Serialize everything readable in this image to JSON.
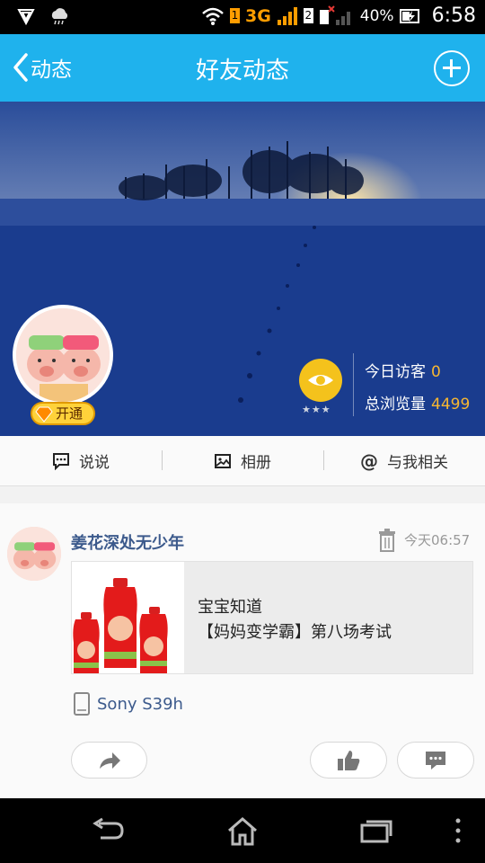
{
  "status_bar": {
    "network": "3G",
    "sim1": "1",
    "sim2": "2",
    "battery": "40%",
    "time": "6:58"
  },
  "header": {
    "back_label": "动态",
    "title": "好友动态",
    "background_color": "#1fb2ed"
  },
  "profile": {
    "vip_label": "开通",
    "visitors_today_label": "今日访客",
    "visitors_today": "0",
    "total_views_label": "总浏览量",
    "total_views": "4499",
    "stars": "★★★"
  },
  "tabs": [
    {
      "label": "说说",
      "icon": "chat-bubble-icon"
    },
    {
      "label": "相册",
      "icon": "photo-icon"
    },
    {
      "label": "与我相关",
      "icon": "at-icon"
    }
  ],
  "feed": {
    "username": "姜花深处无少年",
    "time": "今天06:57",
    "share_title": "宝宝知道",
    "share_desc": "【妈妈变学霸】第八场考试",
    "device": "Sony S39h",
    "actions": [
      "share-icon",
      "like-icon",
      "comment-icon"
    ]
  },
  "nav": [
    "back-icon",
    "home-icon",
    "recent-apps-icon",
    "menu-icon"
  ]
}
